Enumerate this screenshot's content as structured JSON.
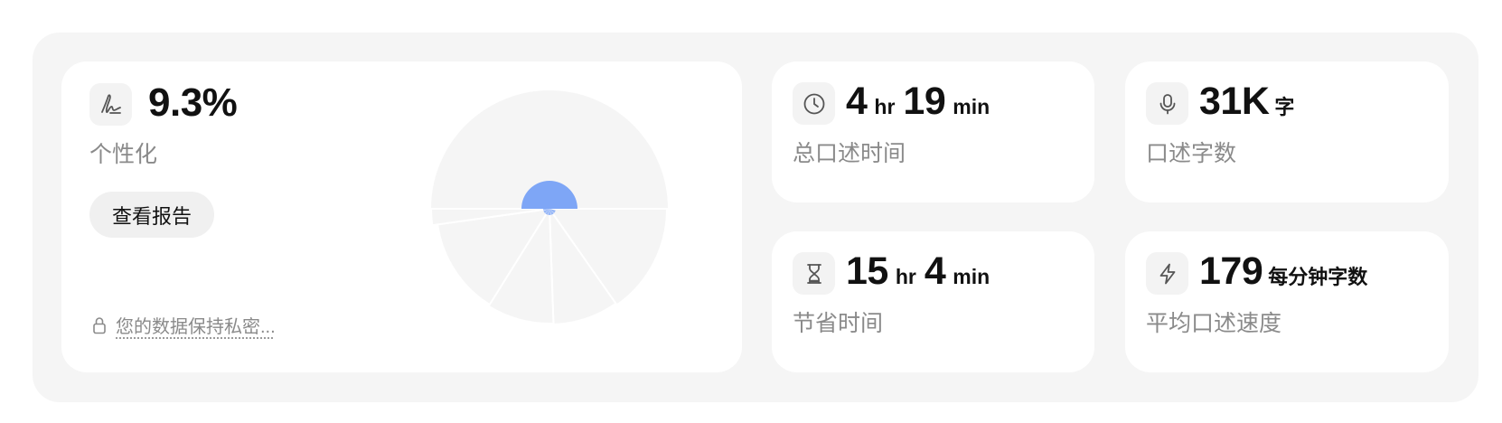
{
  "personalization": {
    "value": "9.3%",
    "label": "个性化",
    "button_label": "查看报告",
    "privacy_text": "您的数据保持私密...",
    "pie": {
      "highlight_color": "#7ea6f6",
      "segment_color": "#f5f5f5"
    }
  },
  "stats": {
    "total_time": {
      "hours": "4",
      "hours_unit": "hr",
      "minutes": "19",
      "minutes_unit": "min",
      "label": "总口述时间",
      "icon": "clock-icon"
    },
    "word_count": {
      "value": "31K",
      "unit": "字",
      "label": "口述字数",
      "icon": "microphone-icon"
    },
    "time_saved": {
      "hours": "15",
      "hours_unit": "hr",
      "minutes": "4",
      "minutes_unit": "min",
      "label": "节省时间",
      "icon": "hourglass-icon"
    },
    "avg_speed": {
      "value": "179",
      "unit": "每分钟字数",
      "label": "平均口述速度",
      "icon": "lightning-icon"
    }
  }
}
